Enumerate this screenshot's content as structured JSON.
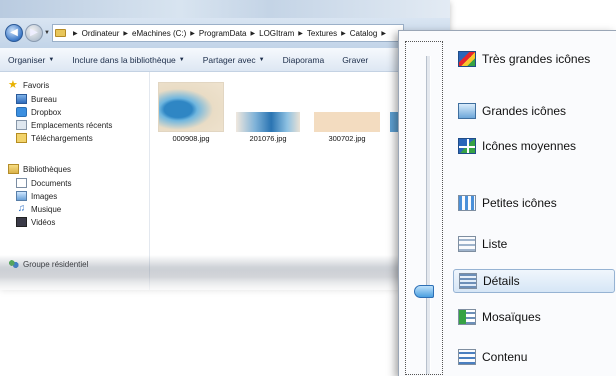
{
  "address": {
    "crumbs": [
      "Ordinateur",
      "eMachines (C:)",
      "ProgramData",
      "LOGItram",
      "Textures",
      "Catalog"
    ]
  },
  "toolbar": {
    "organize": "Organiser",
    "include": "Inclure dans la bibliothèque",
    "share": "Partager avec",
    "slideshow": "Diaporama",
    "burn": "Graver"
  },
  "navpane": {
    "favorites": "Favoris",
    "desktop": "Bureau",
    "dropbox": "Dropbox",
    "recent": "Emplacements récents",
    "downloads": "Téléchargements",
    "libraries": "Bibliothèques",
    "documents": "Documents",
    "images": "Images",
    "music": "Musique",
    "videos": "Vidéos",
    "homegroup": "Groupe résidentiel"
  },
  "files": [
    {
      "name": "000908.jpg"
    },
    {
      "name": "201076.jpg"
    },
    {
      "name": "300702.jpg"
    }
  ],
  "views_menu": {
    "items": [
      {
        "label": "Très grandes icônes",
        "icon": "extra-large-icons-icon"
      },
      {
        "label": "Grandes icônes",
        "icon": "large-icons-icon"
      },
      {
        "label": "Icônes moyennes",
        "icon": "medium-icons-icon"
      },
      {
        "label": "Petites icônes",
        "icon": "small-icons-icon"
      },
      {
        "label": "Liste",
        "icon": "list-icon"
      },
      {
        "label": "Détails",
        "icon": "details-icon"
      },
      {
        "label": "Mosaïques",
        "icon": "tiles-icon"
      },
      {
        "label": "Contenu",
        "icon": "content-icon"
      }
    ],
    "selected": "Détails"
  },
  "colors": {
    "accent": "#3d79c7",
    "selection": "#d6e6f6"
  }
}
